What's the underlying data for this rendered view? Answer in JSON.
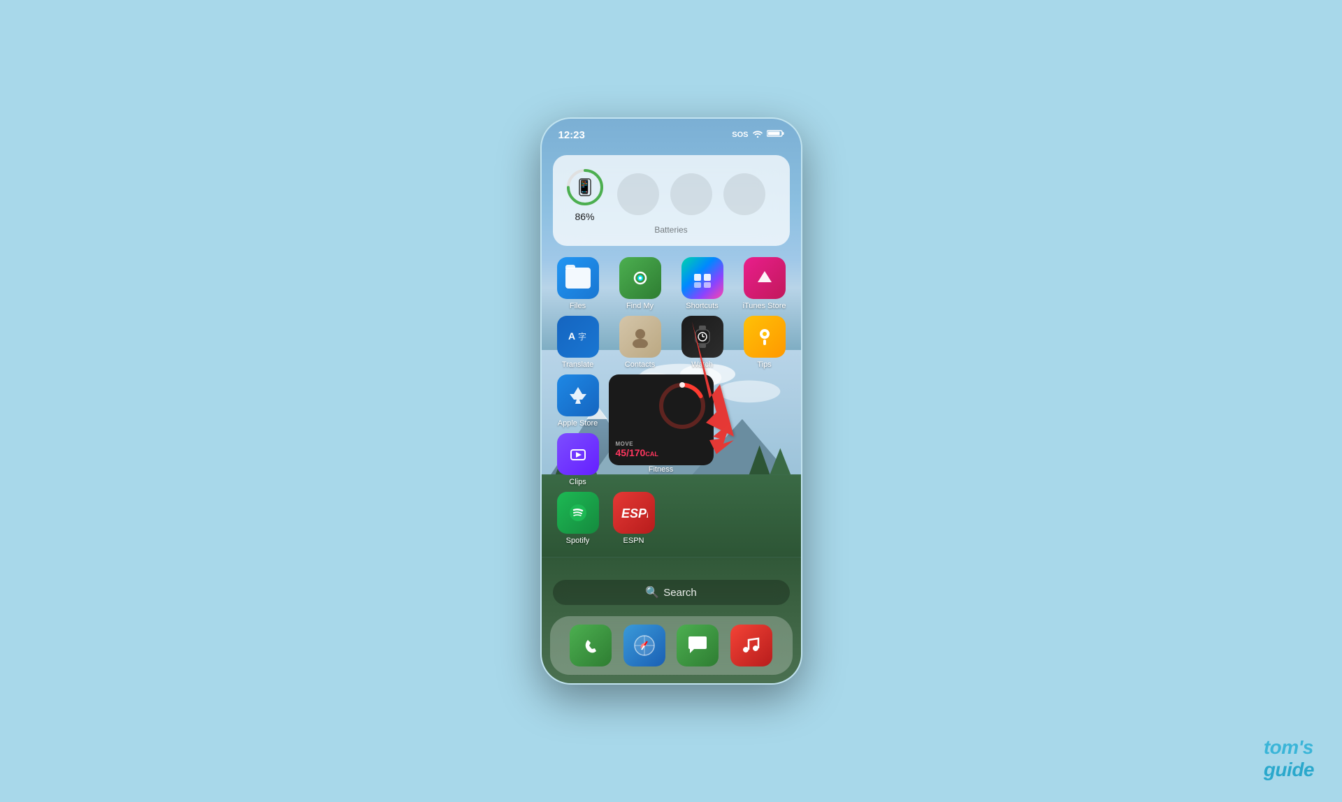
{
  "background": {
    "color": "#a8d8ea"
  },
  "watermark": {
    "text1": "tom's",
    "text2": "guide"
  },
  "statusBar": {
    "time": "12:23",
    "sos": "SOS",
    "wifiIcon": "wifi-icon",
    "batteryIcon": "battery-icon"
  },
  "batteryWidget": {
    "label": "Batteries",
    "mainDevice": {
      "percent": "86%",
      "percentValue": 86
    }
  },
  "apps": {
    "row1": [
      {
        "id": "files",
        "label": "Files",
        "iconClass": "icon-files"
      },
      {
        "id": "findmy",
        "label": "Find My",
        "iconClass": "icon-findmy"
      },
      {
        "id": "shortcuts",
        "label": "Shortcuts",
        "iconClass": "icon-shortcuts shortcuts-gradient"
      },
      {
        "id": "itunes",
        "label": "iTunes Store",
        "iconClass": "icon-itunes"
      }
    ],
    "row2": [
      {
        "id": "translate",
        "label": "Translate",
        "iconClass": "icon-translate"
      },
      {
        "id": "contacts",
        "label": "Contacts",
        "iconClass": "icon-contacts"
      },
      {
        "id": "watch",
        "label": "Watch",
        "iconClass": "icon-watch"
      },
      {
        "id": "tips",
        "label": "Tips",
        "iconClass": "icon-tips"
      }
    ],
    "row3left": [
      {
        "id": "applestore",
        "label": "Apple Store",
        "iconClass": "icon-applestore"
      },
      {
        "id": "clips",
        "label": "Clips",
        "iconClass": "icon-clips"
      }
    ],
    "fitnessWidget": {
      "label": "Fitness",
      "moveLabel": "MOVE",
      "calories": "45/170",
      "caloriesUnit": "CAL"
    },
    "row4left": [
      {
        "id": "spotify",
        "label": "Spotify",
        "iconClass": "icon-spotify"
      },
      {
        "id": "espn",
        "label": "ESPN",
        "iconClass": "icon-espn"
      }
    ]
  },
  "searchBar": {
    "label": "Search",
    "icon": "search-icon"
  },
  "dock": [
    {
      "id": "phone",
      "iconClass": "icon-phone",
      "label": "Phone"
    },
    {
      "id": "safari",
      "iconClass": "icon-safari",
      "label": "Safari"
    },
    {
      "id": "messages",
      "iconClass": "icon-messages",
      "label": "Messages"
    },
    {
      "id": "music",
      "iconClass": "icon-music",
      "label": "Music"
    }
  ]
}
